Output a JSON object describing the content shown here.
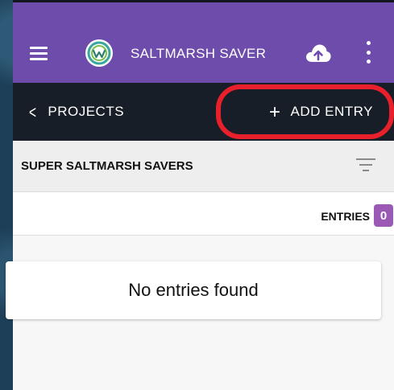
{
  "app_bar": {
    "title": "SALTMARSH SAVER",
    "menu_icon": "menu-icon",
    "logo_icon": "saltmarsh-logo",
    "upload_icon": "cloud-upload-icon",
    "more_icon": "more-vert-icon",
    "color": "#6d4cab"
  },
  "nav_bar": {
    "back_label": "PROJECTS",
    "back_icon": "chevron-left-icon",
    "add_label": "ADD ENTRY",
    "add_icon": "plus-icon",
    "color": "#181e27",
    "highlight_color": "#e8202b"
  },
  "project": {
    "name": "SUPER SALTMARSH SAVERS",
    "filter_icon": "filter-icon"
  },
  "entries": {
    "label": "ENTRIES",
    "count": "0",
    "badge_color": "#9b59b6"
  },
  "empty_state": {
    "message": "No entries found"
  }
}
